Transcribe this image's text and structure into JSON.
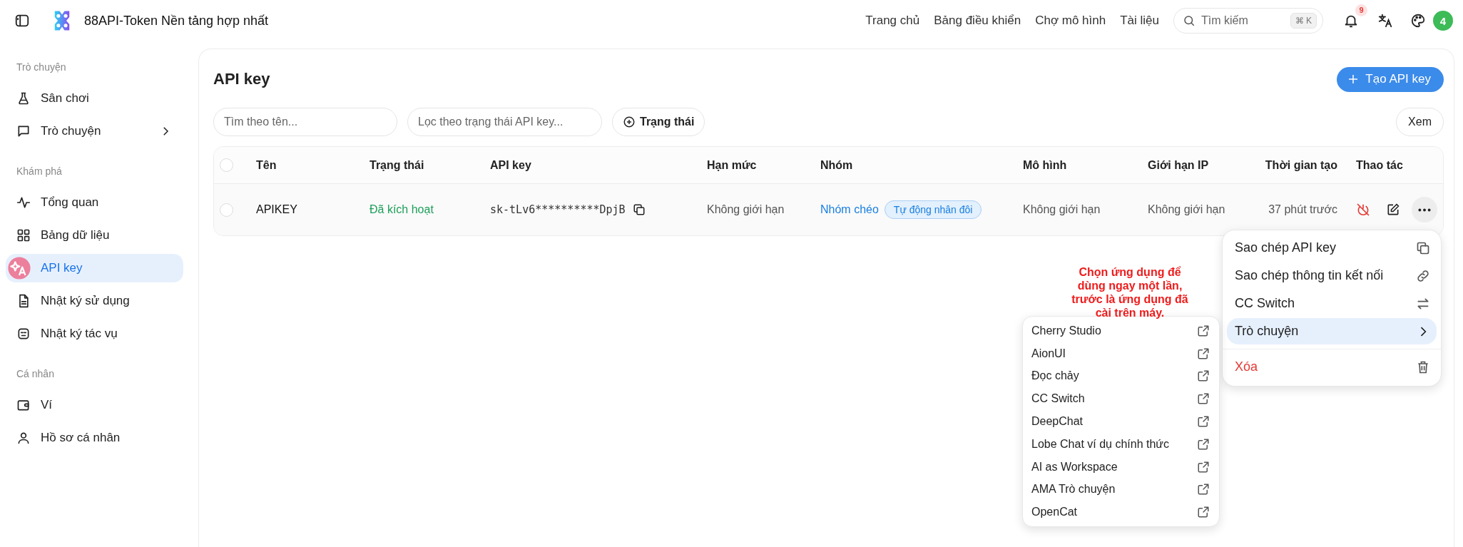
{
  "header": {
    "brand": "88API-Token Nền tảng hợp nhất",
    "nav": [
      "Trang chủ",
      "Bảng điều khiển",
      "Chợ mô hình",
      "Tài liệu"
    ],
    "search": {
      "placeholder": "Tìm kiếm",
      "shortcut": "⌘ K"
    },
    "notification_count": "9",
    "avatar": "4"
  },
  "sidebar": {
    "sections": [
      {
        "title": "Trò chuyện",
        "items": [
          {
            "label": "Sân chơi",
            "selected": false,
            "has_submenu": false
          },
          {
            "label": "Trò chuyện",
            "selected": false,
            "has_submenu": true
          }
        ]
      },
      {
        "title": "Khám phá",
        "items": [
          {
            "label": "Tổng quan",
            "selected": false,
            "has_submenu": false
          },
          {
            "label": "Bảng dữ liệu",
            "selected": false,
            "has_submenu": false
          },
          {
            "label": "API key",
            "selected": true,
            "has_submenu": false
          },
          {
            "label": "Nhật ký sử dụng",
            "selected": false,
            "has_submenu": false
          },
          {
            "label": "Nhật ký tác vụ",
            "selected": false,
            "has_submenu": false
          }
        ]
      },
      {
        "title": "Cá nhân",
        "items": [
          {
            "label": "Ví",
            "selected": false,
            "has_submenu": false
          },
          {
            "label": "Hồ sơ cá nhân",
            "selected": false,
            "has_submenu": false
          }
        ]
      }
    ]
  },
  "page": {
    "title": "API key",
    "create_button": "Tạo API key",
    "filters": {
      "name_placeholder": "Tìm theo tên...",
      "status_placeholder": "Lọc theo trạng thái API key...",
      "status_button": "Trạng thái"
    },
    "view_button": "Xem"
  },
  "table": {
    "all_checked": false,
    "columns": [
      "Tên",
      "Trạng thái",
      "API key",
      "Hạn mức",
      "Nhóm",
      "Mô hình",
      "Giới hạn IP",
      "Thời gian tạo",
      "Thao tác"
    ],
    "rows": [
      {
        "checked": false,
        "name": "APIKEY",
        "status": "Đã kích hoạt",
        "key": "sk-tLv6**********DpjB",
        "quota": "Không giới hạn",
        "group": "Nhóm chéo",
        "group_tag": "Tự động nhân đôi",
        "model": "Không giới hạn",
        "ip_limit": "Không giới hạn",
        "created": "37 phút trước",
        "menu_open": true
      }
    ]
  },
  "context_menu": {
    "items": [
      {
        "label": "Sao chép API key",
        "kind": "action",
        "selected": false
      },
      {
        "label": "Sao chép thông tin kết nối",
        "kind": "action",
        "selected": false
      },
      {
        "label": "CC Switch",
        "kind": "action",
        "selected": false
      },
      {
        "label": "Trò chuyện",
        "kind": "submenu",
        "selected": true
      },
      {
        "label": "Xóa",
        "kind": "danger",
        "selected": false
      }
    ]
  },
  "submenu": {
    "items": [
      "Cherry Studio",
      "AionUI",
      "Đọc chảy",
      "CC Switch",
      "DeepChat",
      "Lobe Chat ví dụ chính thức",
      "AI as Workspace",
      "AMA Trò chuyện",
      "OpenCat"
    ]
  },
  "annotation": "Chọn ứng dụng để dùng ngay một lần, trước là ứng dụng đã cài trên máy."
}
